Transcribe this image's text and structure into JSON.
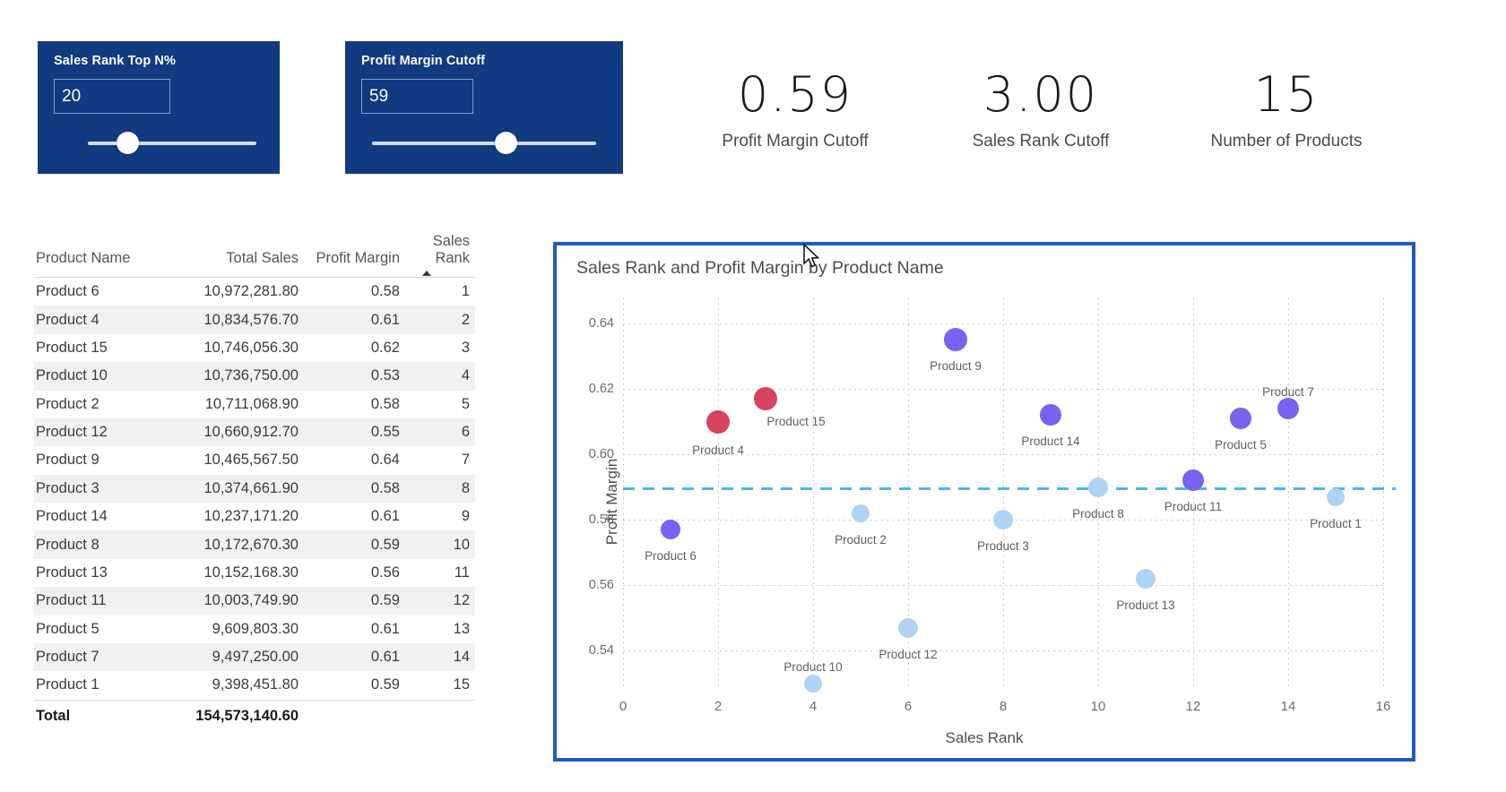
{
  "slicers": [
    {
      "id": "sales-rank-top-n",
      "title": "Sales Rank Top N%",
      "value": "20",
      "placeholder": "",
      "thumb_percent": 17
    },
    {
      "id": "profit-margin-cutoff",
      "title": "Profit Margin Cutoff",
      "value": "59",
      "placeholder": "",
      "thumb_percent": 57
    }
  ],
  "kpis": [
    {
      "value": "0.59",
      "label": "Profit Margin Cutoff"
    },
    {
      "value": "3.00",
      "label": "Sales Rank Cutoff"
    },
    {
      "value": "15",
      "label": "Number of Products"
    }
  ],
  "table": {
    "columns": [
      "Product Name",
      "Total Sales",
      "Profit Margin",
      "Sales Rank"
    ],
    "sorted_column": "Sales Rank",
    "sort_direction": "asc",
    "rows": [
      [
        "Product 6",
        "10,972,281.80",
        "0.58",
        "1"
      ],
      [
        "Product 4",
        "10,834,576.70",
        "0.61",
        "2"
      ],
      [
        "Product 15",
        "10,746,056.30",
        "0.62",
        "3"
      ],
      [
        "Product 10",
        "10,736,750.00",
        "0.53",
        "4"
      ],
      [
        "Product 2",
        "10,711,068.90",
        "0.58",
        "5"
      ],
      [
        "Product 12",
        "10,660,912.70",
        "0.55",
        "6"
      ],
      [
        "Product 9",
        "10,465,567.50",
        "0.64",
        "7"
      ],
      [
        "Product 3",
        "10,374,661.90",
        "0.58",
        "8"
      ],
      [
        "Product 14",
        "10,237,171.20",
        "0.61",
        "9"
      ],
      [
        "Product 8",
        "10,172,670.30",
        "0.59",
        "10"
      ],
      [
        "Product 13",
        "10,152,168.30",
        "0.56",
        "11"
      ],
      [
        "Product 11",
        "10,003,749.90",
        "0.59",
        "12"
      ],
      [
        "Product 5",
        "9,609,803.30",
        "0.61",
        "13"
      ],
      [
        "Product 7",
        "9,497,250.00",
        "0.61",
        "14"
      ],
      [
        "Product 1",
        "9,398,451.80",
        "0.59",
        "15"
      ]
    ],
    "total": {
      "label": "Total",
      "total_sales": "154,573,140.60",
      "profit_margin": "",
      "sales_rank": ""
    }
  },
  "chart_data": {
    "type": "scatter",
    "title": "Sales Rank and Profit Margin by Product Name",
    "xlabel": "Sales Rank",
    "ylabel": "Profit Margin",
    "xlim": [
      0,
      16
    ],
    "ylim": [
      0.528,
      0.648
    ],
    "xticks": [
      "0",
      "2",
      "4",
      "6",
      "8",
      "10",
      "12",
      "14",
      "16"
    ],
    "yticks": [
      "0.64",
      "0.62",
      "0.60",
      "0.58",
      "0.56",
      "0.54"
    ],
    "grid": true,
    "legend": "none",
    "reference_line": {
      "value": 0.59,
      "label": "Profit Margin Cutoff",
      "color": "#4eb3f0",
      "style": "dashed"
    },
    "colors": {
      "above_cutoff_high": "#7b61f0",
      "top_rank": "#d6435a",
      "below_cutoff": "#aed4f5"
    },
    "points": [
      {
        "label": "Product 6",
        "x": 1,
        "y": 0.577,
        "color": "#7b61f0",
        "r": 11,
        "label_dx": 0,
        "label_dy": 22
      },
      {
        "label": "Product 4",
        "x": 2,
        "y": 0.61,
        "color": "#d6435a",
        "r": 13,
        "label_dx": 0,
        "label_dy": 24
      },
      {
        "label": "Product 15",
        "x": 3,
        "y": 0.617,
        "color": "#d6435a",
        "r": 13,
        "label_dx": 34,
        "label_dy": 18
      },
      {
        "label": "Product 10",
        "x": 4,
        "y": 0.53,
        "color": "#aed4f5",
        "r": 10,
        "label_dx": 0,
        "label_dy": -26
      },
      {
        "label": "Product 2",
        "x": 5,
        "y": 0.582,
        "color": "#aed4f5",
        "r": 10,
        "label_dx": 0,
        "label_dy": 22
      },
      {
        "label": "Product 12",
        "x": 6,
        "y": 0.547,
        "color": "#aed4f5",
        "r": 11,
        "label_dx": 0,
        "label_dy": 22
      },
      {
        "label": "Product 9",
        "x": 7,
        "y": 0.635,
        "color": "#7b61f0",
        "r": 13,
        "label_dx": 0,
        "label_dy": 22
      },
      {
        "label": "Product 3",
        "x": 8,
        "y": 0.58,
        "color": "#aed4f5",
        "r": 11,
        "label_dx": 0,
        "label_dy": 22
      },
      {
        "label": "Product 14",
        "x": 9,
        "y": 0.612,
        "color": "#7b61f0",
        "r": 12,
        "label_dx": 0,
        "label_dy": 22
      },
      {
        "label": "Product 8",
        "x": 10,
        "y": 0.59,
        "color": "#aed4f5",
        "r": 11,
        "label_dx": 0,
        "label_dy": 22
      },
      {
        "label": "Product 13",
        "x": 11,
        "y": 0.562,
        "color": "#aed4f5",
        "r": 11,
        "label_dx": 0,
        "label_dy": 22
      },
      {
        "label": "Product 11",
        "x": 12,
        "y": 0.592,
        "color": "#7b61f0",
        "r": 12,
        "label_dx": 0,
        "label_dy": 22
      },
      {
        "label": "Product 5",
        "x": 13,
        "y": 0.611,
        "color": "#7b61f0",
        "r": 12,
        "label_dx": 0,
        "label_dy": 22
      },
      {
        "label": "Product 7",
        "x": 14,
        "y": 0.614,
        "color": "#7b61f0",
        "r": 12,
        "label_dx": 0,
        "label_dy": -26
      },
      {
        "label": "Product 1",
        "x": 15,
        "y": 0.587,
        "color": "#aed4f5",
        "r": 10,
        "label_dx": 0,
        "label_dy": 22
      }
    ]
  }
}
